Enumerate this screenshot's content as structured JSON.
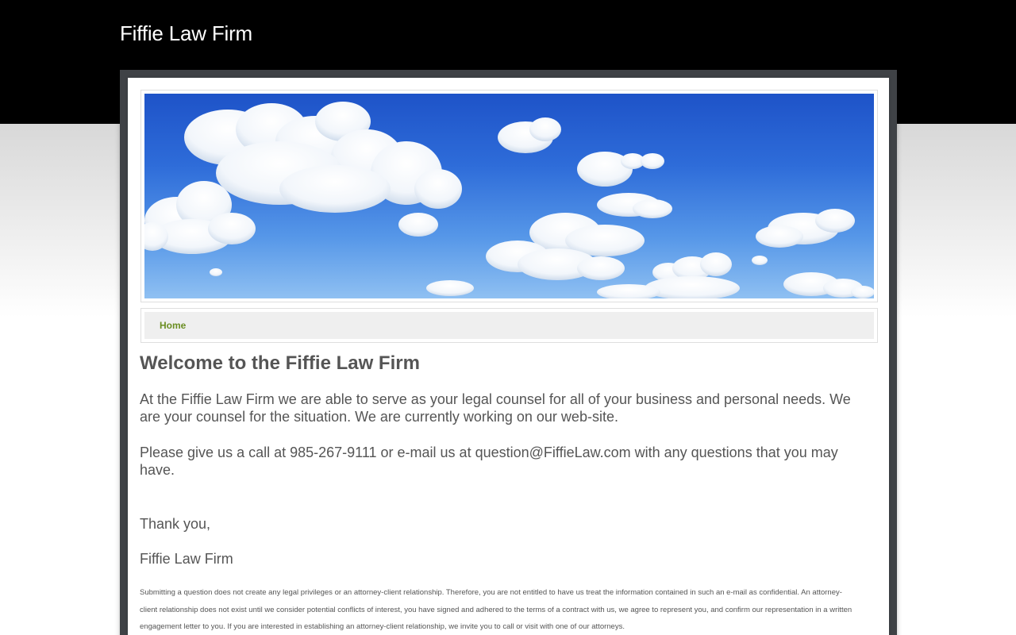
{
  "site": {
    "title": "Fiffie Law Firm"
  },
  "nav": {
    "items": [
      {
        "label": "Home",
        "color": "#6b8e23"
      }
    ]
  },
  "banner": {
    "description_icon": "sky-clouds-image"
  },
  "main": {
    "heading": "Welcome to the Fiffie Law Firm",
    "paragraphs": [
      "At the Fiffie Law Firm we are able to serve as your legal counsel for all of your business and personal needs. We are your counsel for the situation. We are currently working on our web-site.",
      "Please give us a call at 985-267-9111 or e-mail us at question@FiffieLaw.com with any questions that you may have.",
      "Thank you,",
      "Fiffie Law Firm"
    ],
    "disclaimer": "Submitting a question does not create any legal privileges or an attorney-client relationship. Therefore, you are not entitled to have us treat the information contained in such an e-mail as confidential. An attorney-client relationship does not exist until we consider potential conflicts of interest, you have signed and adhered to the terms of a contract with us, we agree to represent you, and confirm our representation in a written engagement letter to you. If you are interested in establishing an attorney-client relationship, we invite you to call or visit with one of our attorneys."
  },
  "colors": {
    "header_background": "#000000",
    "text": "#555555",
    "nav_background": "#efefef",
    "nav_link": "#6b8e23"
  }
}
